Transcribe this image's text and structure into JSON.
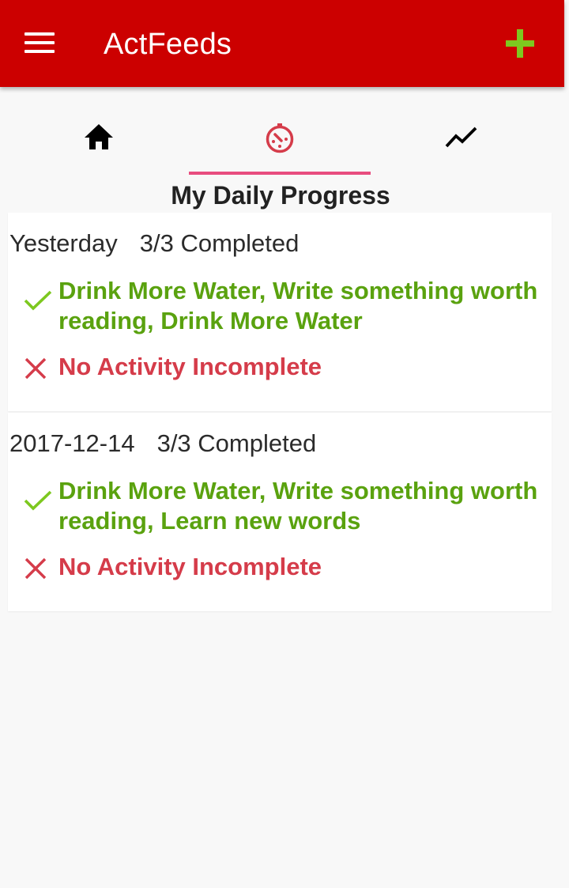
{
  "app": {
    "title": "ActFeeds",
    "colors": {
      "toolbar": "#cc0000",
      "add_icon": "#7dc81f",
      "tab_indicator": "#e84d7f",
      "completed": "#5aa20f",
      "incomplete": "#d53c4a"
    }
  },
  "toolbar": {
    "menu_icon": "hamburger-menu-icon",
    "add_icon": "plus-icon"
  },
  "tabs": [
    {
      "icon": "home-icon",
      "selected": false
    },
    {
      "icon": "timer-progress-icon",
      "selected": true
    },
    {
      "icon": "trending-line-icon",
      "selected": false
    }
  ],
  "page": {
    "title": "My Daily Progress"
  },
  "entries": [
    {
      "date": "Yesterday",
      "summary": "3/3 Completed",
      "completed_icon": "check-icon",
      "completed_text": "Drink More Water, Write something worth reading, Drink More Water",
      "incomplete_icon": "cross-icon",
      "incomplete_text": "No Activity Incomplete"
    },
    {
      "date": "2017-12-14",
      "summary": "3/3 Completed",
      "completed_icon": "check-icon",
      "completed_text": "Drink More Water, Write something worth reading, Learn new words",
      "incomplete_icon": "cross-icon",
      "incomplete_text": "No Activity Incomplete"
    }
  ]
}
